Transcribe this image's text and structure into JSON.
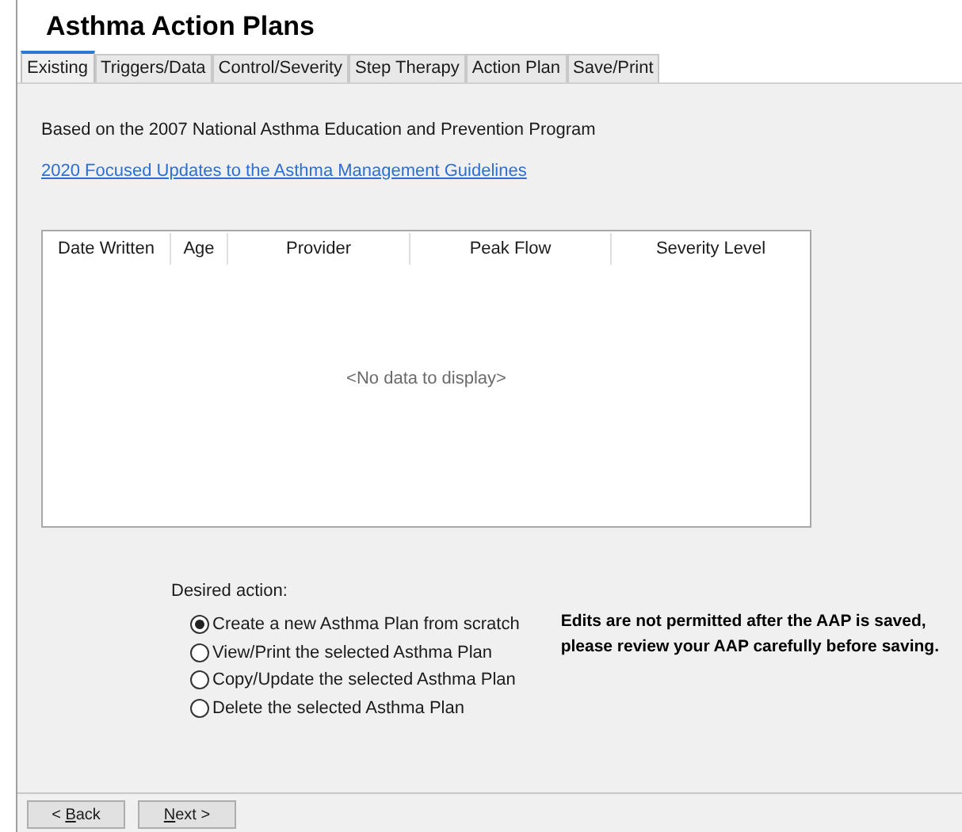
{
  "window": {
    "title": "Asthma Action Plans"
  },
  "tabs": [
    {
      "label": "Existing",
      "selected": true
    },
    {
      "label": "Triggers/Data",
      "selected": false
    },
    {
      "label": "Control/Severity",
      "selected": false
    },
    {
      "label": "Step Therapy",
      "selected": false
    },
    {
      "label": "Action Plan",
      "selected": false
    },
    {
      "label": "Save/Print",
      "selected": false
    }
  ],
  "intro": "Based on the 2007 National Asthma Education and Prevention Program",
  "link": "2020 Focused Updates to the Asthma Management Guidelines",
  "table": {
    "columns": [
      "Date Written",
      "Age",
      "Provider",
      "Peak Flow",
      "Severity Level"
    ],
    "empty_message": "<No data to display>"
  },
  "action_label": "Desired action:",
  "actions": [
    {
      "label": "Create a new Asthma Plan from scratch",
      "selected": true
    },
    {
      "label": "View/Print the selected Asthma Plan",
      "selected": false
    },
    {
      "label": "Copy/Update the selected Asthma Plan",
      "selected": false
    },
    {
      "label": "Delete the selected Asthma Plan",
      "selected": false
    }
  ],
  "warning": "Edits are not permitted after the AAP is saved, please review your AAP carefully before saving.",
  "buttons": [
    {
      "before": "< ",
      "key": "B",
      "after": "ack"
    },
    {
      "key": "N",
      "after": "ext >"
    }
  ]
}
